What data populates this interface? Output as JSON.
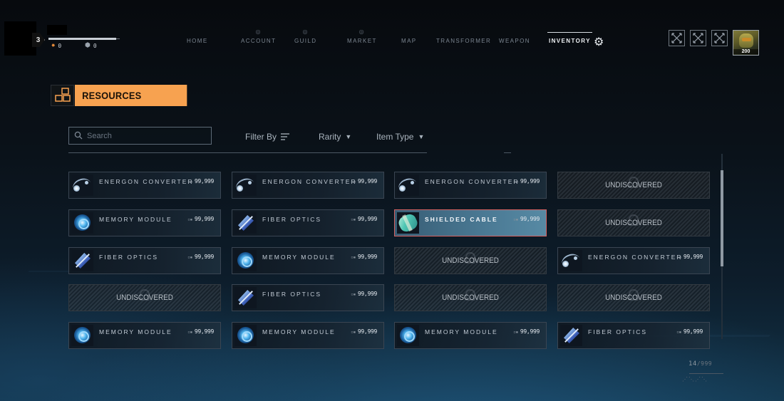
{
  "player": {
    "level": "3",
    "xp_fraction": 0.95,
    "currency_primary": "0",
    "currency_secondary": "0",
    "portrait_level": "200"
  },
  "nav": {
    "items": [
      {
        "label": "HOME",
        "locked": false,
        "active": false
      },
      {
        "label": "ACCOUNT",
        "locked": true,
        "active": false
      },
      {
        "label": "GUILD",
        "locked": true,
        "active": false
      },
      {
        "label": "MARKET",
        "locked": true,
        "active": false
      },
      {
        "label": "MAP",
        "locked": false,
        "active": false
      },
      {
        "label": "TRANSFORMER",
        "locked": false,
        "active": false
      },
      {
        "label": "WEAPON",
        "locked": false,
        "active": false
      },
      {
        "label": "INVENTORY",
        "locked": false,
        "active": true
      }
    ],
    "settings_icon": "gear-icon"
  },
  "section": {
    "title": "RESOURCES",
    "icon": "grid-squares-icon"
  },
  "filters": {
    "search_placeholder": "Search",
    "filter_by_label": "Filter By",
    "rarity_label": "Rarity",
    "item_type_label": "Item Type"
  },
  "grid": {
    "rows": [
      [
        {
          "name": "ENERGON CONVERTER",
          "qty": "99,999",
          "icon": "energon",
          "state": "normal"
        },
        {
          "name": "ENERGON CONVERTER",
          "qty": "99,999",
          "icon": "energon",
          "state": "normal"
        },
        {
          "name": "ENERGON CONVERTER",
          "qty": "99,999",
          "icon": "energon",
          "state": "normal"
        },
        {
          "name": "UNDISCOVERED",
          "qty": "",
          "icon": "",
          "state": "locked"
        }
      ],
      [
        {
          "name": "MEMORY MODULE",
          "qty": "99,999",
          "icon": "memory",
          "state": "normal"
        },
        {
          "name": "FIBER OPTICS",
          "qty": "99,999",
          "icon": "fiber",
          "state": "normal"
        },
        {
          "name": "SHIELDED CABLE",
          "qty": "99,999",
          "icon": "cable",
          "state": "selected"
        },
        {
          "name": "UNDISCOVERED",
          "qty": "",
          "icon": "",
          "state": "locked"
        }
      ],
      [
        {
          "name": "FIBER OPTICS",
          "qty": "99,999",
          "icon": "fiber",
          "state": "normal"
        },
        {
          "name": "MEMORY MODULE",
          "qty": "99,999",
          "icon": "memory",
          "state": "normal"
        },
        {
          "name": "UNDISCOVERED",
          "qty": "",
          "icon": "",
          "state": "locked"
        },
        {
          "name": "ENERGON CONVERTER",
          "qty": "99,999",
          "icon": "energon",
          "state": "normal"
        }
      ],
      [
        {
          "name": "UNDISCOVERED",
          "qty": "",
          "icon": "",
          "state": "locked"
        },
        {
          "name": "FIBER OPTICS",
          "qty": "99,999",
          "icon": "fiber",
          "state": "normal"
        },
        {
          "name": "UNDISCOVERED",
          "qty": "",
          "icon": "",
          "state": "locked"
        },
        {
          "name": "UNDISCOVERED",
          "qty": "",
          "icon": "",
          "state": "locked"
        }
      ],
      [
        {
          "name": "MEMORY MODULE",
          "qty": "99,999",
          "icon": "memory",
          "state": "normal"
        },
        {
          "name": "MEMORY MODULE",
          "qty": "99,999",
          "icon": "memory",
          "state": "normal"
        },
        {
          "name": "MEMORY MODULE",
          "qty": "99,999",
          "icon": "memory",
          "state": "normal"
        },
        {
          "name": "FIBER OPTICS",
          "qty": "99,999",
          "icon": "fiber",
          "state": "normal"
        }
      ]
    ]
  },
  "pager": {
    "current": "14",
    "total": "999"
  },
  "scroll": {
    "position_fraction": 0.18
  },
  "colors": {
    "accent": "#f7a250",
    "selected_border": "#d46262"
  }
}
